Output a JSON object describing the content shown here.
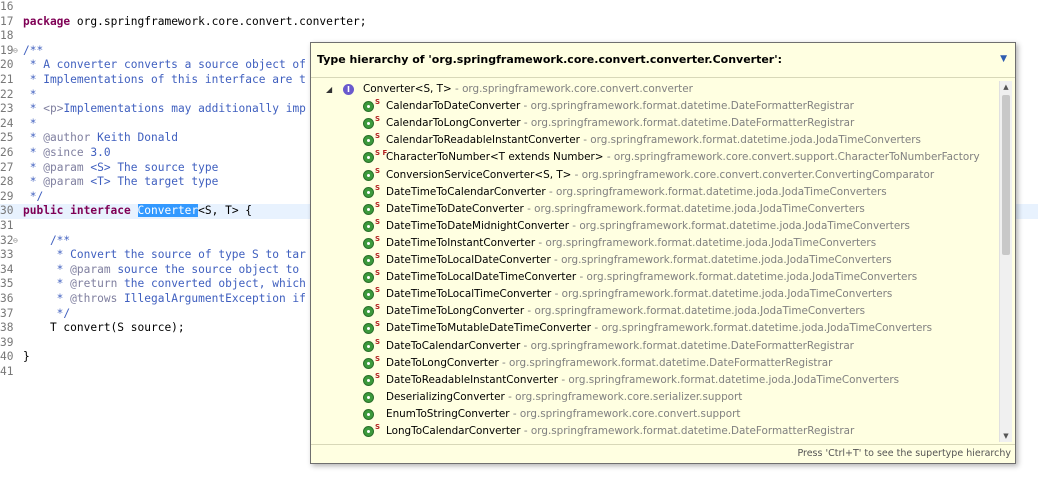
{
  "editor": {
    "lines": [
      {
        "n": "16",
        "fold": "",
        "tokens": []
      },
      {
        "n": "17",
        "fold": "",
        "tokens": [
          {
            "t": "kw",
            "v": "package"
          },
          {
            "t": "plain",
            "v": " org.springframework.core.convert.converter;"
          }
        ]
      },
      {
        "n": "18",
        "fold": "",
        "tokens": []
      },
      {
        "n": "19",
        "fold": "⊖",
        "tokens": [
          {
            "t": "cm",
            "v": "/**"
          }
        ]
      },
      {
        "n": "20",
        "fold": "",
        "tokens": [
          {
            "t": "cm",
            "v": " * A converter converts a source object of"
          }
        ]
      },
      {
        "n": "21",
        "fold": "",
        "tokens": [
          {
            "t": "cm",
            "v": " * Implementations of this interface are t"
          }
        ]
      },
      {
        "n": "22",
        "fold": "",
        "tokens": [
          {
            "t": "cm",
            "v": " *"
          }
        ]
      },
      {
        "n": "23",
        "fold": "",
        "tokens": [
          {
            "t": "cm",
            "v": " * "
          },
          {
            "t": "tg",
            "v": "<p>"
          },
          {
            "t": "cm",
            "v": "Implementations may additionally imp"
          }
        ]
      },
      {
        "n": "24",
        "fold": "",
        "tokens": [
          {
            "t": "cm",
            "v": " *"
          }
        ]
      },
      {
        "n": "25",
        "fold": "",
        "tokens": [
          {
            "t": "cm",
            "v": " * "
          },
          {
            "t": "tg",
            "v": "@author"
          },
          {
            "t": "cm",
            "v": " Keith Donald"
          }
        ]
      },
      {
        "n": "26",
        "fold": "",
        "tokens": [
          {
            "t": "cm",
            "v": " * "
          },
          {
            "t": "tg",
            "v": "@since"
          },
          {
            "t": "cm",
            "v": " 3.0"
          }
        ]
      },
      {
        "n": "27",
        "fold": "",
        "tokens": [
          {
            "t": "cm",
            "v": " * "
          },
          {
            "t": "tg",
            "v": "@param"
          },
          {
            "t": "cm",
            "v": " <S> The source type"
          }
        ]
      },
      {
        "n": "28",
        "fold": "",
        "tokens": [
          {
            "t": "cm",
            "v": " * "
          },
          {
            "t": "tg",
            "v": "@param"
          },
          {
            "t": "cm",
            "v": " <T> The target type"
          }
        ]
      },
      {
        "n": "29",
        "fold": "",
        "tokens": [
          {
            "t": "cm",
            "v": " */"
          }
        ]
      },
      {
        "n": "30",
        "fold": "",
        "current": true,
        "tokens": [
          {
            "t": "kw",
            "v": "public interface"
          },
          {
            "t": "plain",
            "v": " "
          },
          {
            "t": "hl",
            "v": "Converter"
          },
          {
            "t": "plain",
            "v": "<S, T> {"
          }
        ]
      },
      {
        "n": "31",
        "fold": "",
        "tokens": []
      },
      {
        "n": "32",
        "fold": "⊖",
        "tokens": [
          {
            "t": "cm",
            "v": "    /**"
          }
        ]
      },
      {
        "n": "33",
        "fold": "",
        "tokens": [
          {
            "t": "cm",
            "v": "     * Convert the source of type S to tar"
          }
        ]
      },
      {
        "n": "34",
        "fold": "",
        "tokens": [
          {
            "t": "cm",
            "v": "     * "
          },
          {
            "t": "tg",
            "v": "@param"
          },
          {
            "t": "cm",
            "v": " source the source object to"
          }
        ]
      },
      {
        "n": "35",
        "fold": "",
        "tokens": [
          {
            "t": "cm",
            "v": "     * "
          },
          {
            "t": "tg",
            "v": "@return"
          },
          {
            "t": "cm",
            "v": " the converted object, which"
          }
        ]
      },
      {
        "n": "36",
        "fold": "",
        "tokens": [
          {
            "t": "cm",
            "v": "     * "
          },
          {
            "t": "tg",
            "v": "@throws"
          },
          {
            "t": "cm",
            "v": " IllegalArgumentException if"
          }
        ]
      },
      {
        "n": "37",
        "fold": "",
        "tokens": [
          {
            "t": "cm",
            "v": "     */"
          }
        ]
      },
      {
        "n": "38",
        "fold": "",
        "tokens": [
          {
            "t": "plain",
            "v": "    T convert(S source);"
          }
        ]
      },
      {
        "n": "39",
        "fold": "",
        "tokens": []
      },
      {
        "n": "40",
        "fold": "",
        "tokens": [
          {
            "t": "plain",
            "v": "}"
          }
        ]
      },
      {
        "n": "41",
        "fold": "",
        "tokens": []
      }
    ]
  },
  "popup": {
    "title": "Type hierarchy of 'org.springframework.core.convert.converter.Converter':",
    "menu_icon": "chevron-down-icon",
    "footer_hint": "Press 'Ctrl+T' to see the supertype hierarchy",
    "root": {
      "name": "Converter<S, T>",
      "separator": " - ",
      "package": "org.springframework.core.convert.converter",
      "icon": "interface-icon",
      "expanded_glyph": "◢"
    },
    "items": [
      {
        "name": "CalendarToDateConverter",
        "package": "org.springframework.format.datetime.DateFormatterRegistrar",
        "dec": "S",
        "icon": "class-icon"
      },
      {
        "name": "CalendarToLongConverter",
        "package": "org.springframework.format.datetime.DateFormatterRegistrar",
        "dec": "S",
        "icon": "class-icon"
      },
      {
        "name": "CalendarToReadableInstantConverter",
        "package": "org.springframework.format.datetime.joda.JodaTimeConverters",
        "dec": "S",
        "icon": "class-icon"
      },
      {
        "name": "CharacterToNumber<T extends Number>",
        "package": "org.springframework.core.convert.support.CharacterToNumberFactory",
        "dec": "S F",
        "icon": "class-icon"
      },
      {
        "name": "ConversionServiceConverter<S, T>",
        "package": "org.springframework.core.convert.converter.ConvertingComparator",
        "dec": "S",
        "icon": "class-icon"
      },
      {
        "name": "DateTimeToCalendarConverter",
        "package": "org.springframework.format.datetime.joda.JodaTimeConverters",
        "dec": "S",
        "icon": "class-icon"
      },
      {
        "name": "DateTimeToDateConverter",
        "package": "org.springframework.format.datetime.joda.JodaTimeConverters",
        "dec": "S",
        "icon": "class-icon"
      },
      {
        "name": "DateTimeToDateMidnightConverter",
        "package": "org.springframework.format.datetime.joda.JodaTimeConverters",
        "dec": "S",
        "icon": "class-icon"
      },
      {
        "name": "DateTimeToInstantConverter",
        "package": "org.springframework.format.datetime.joda.JodaTimeConverters",
        "dec": "S",
        "icon": "class-icon"
      },
      {
        "name": "DateTimeToLocalDateConverter",
        "package": "org.springframework.format.datetime.joda.JodaTimeConverters",
        "dec": "S",
        "icon": "class-icon"
      },
      {
        "name": "DateTimeToLocalDateTimeConverter",
        "package": "org.springframework.format.datetime.joda.JodaTimeConverters",
        "dec": "S",
        "icon": "class-icon"
      },
      {
        "name": "DateTimeToLocalTimeConverter",
        "package": "org.springframework.format.datetime.joda.JodaTimeConverters",
        "dec": "S",
        "icon": "class-icon"
      },
      {
        "name": "DateTimeToLongConverter",
        "package": "org.springframework.format.datetime.joda.JodaTimeConverters",
        "dec": "S",
        "icon": "class-icon"
      },
      {
        "name": "DateTimeToMutableDateTimeConverter",
        "package": "org.springframework.format.datetime.joda.JodaTimeConverters",
        "dec": "S",
        "icon": "class-icon"
      },
      {
        "name": "DateToCalendarConverter",
        "package": "org.springframework.format.datetime.DateFormatterRegistrar",
        "dec": "S",
        "icon": "class-icon"
      },
      {
        "name": "DateToLongConverter",
        "package": "org.springframework.format.datetime.DateFormatterRegistrar",
        "dec": "S",
        "icon": "class-icon"
      },
      {
        "name": "DateToReadableInstantConverter",
        "package": "org.springframework.format.datetime.joda.JodaTimeConverters",
        "dec": "S",
        "icon": "class-icon"
      },
      {
        "name": "DeserializingConverter",
        "package": "org.springframework.core.serializer.support",
        "dec": "",
        "icon": "class-icon"
      },
      {
        "name": "EnumToStringConverter",
        "package": "org.springframework.core.convert.support",
        "dec": "",
        "icon": "class-icon"
      },
      {
        "name": "LongToCalendarConverter",
        "package": "org.springframework.format.datetime.DateFormatterRegistrar",
        "dec": "S",
        "icon": "class-icon"
      }
    ]
  },
  "colors": {
    "popup_bg": "#ffffe1",
    "keyword": "#7f0055",
    "comment": "#3f5fbf",
    "selection": "#3399ff",
    "class_icon": "#3c9a3c",
    "interface_icon": "#6a5acd"
  }
}
